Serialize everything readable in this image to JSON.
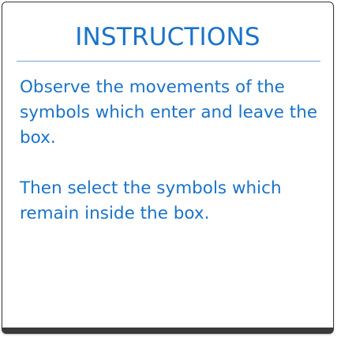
{
  "instructions": {
    "title": "INSTRUCTIONS",
    "paragraph_1": "Observe the movements of the symbols which enter and leave the box.",
    "paragraph_2": "Then select the symbols which remain inside the box."
  },
  "colors": {
    "text": "#1a73c8",
    "divider": "#6aaad8",
    "border": "#3a3a3a"
  }
}
